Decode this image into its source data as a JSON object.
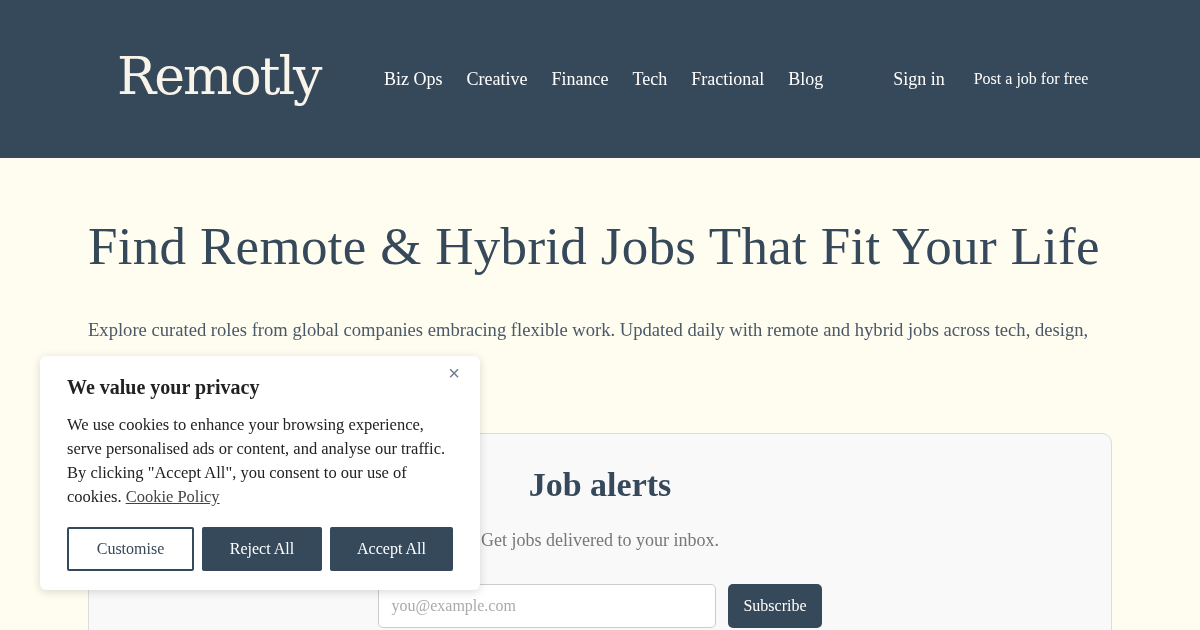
{
  "header": {
    "logo": "Remotly",
    "nav": [
      "Biz Ops",
      "Creative",
      "Finance",
      "Tech",
      "Fractional",
      "Blog"
    ],
    "sign_in": "Sign in",
    "post_job": "Post a job for free"
  },
  "hero": {
    "title": "Find Remote & Hybrid Jobs That Fit Your Life",
    "description": "Explore curated roles from global companies embracing flexible work. Updated daily with remote and hybrid jobs across tech, design,"
  },
  "job_alerts": {
    "title": "Job alerts",
    "subtitle": "Get jobs delivered to your inbox.",
    "email": {
      "placeholder": "you@example.com"
    },
    "button": "Subscribe"
  },
  "cookie_banner": {
    "title": "We value your privacy",
    "text": "We use cookies to enhance your browsing experience, serve personalised ads or content, and analyse our traffic. By clicking \"Accept All\", you consent to our use of cookies.",
    "link": "Cookie Policy",
    "close": "×",
    "buttons": [
      {
        "label": "Customise",
        "kind": "outline"
      },
      {
        "label": "Reject All",
        "kind": "filled"
      },
      {
        "label": "Accept All",
        "kind": "filled"
      }
    ]
  }
}
